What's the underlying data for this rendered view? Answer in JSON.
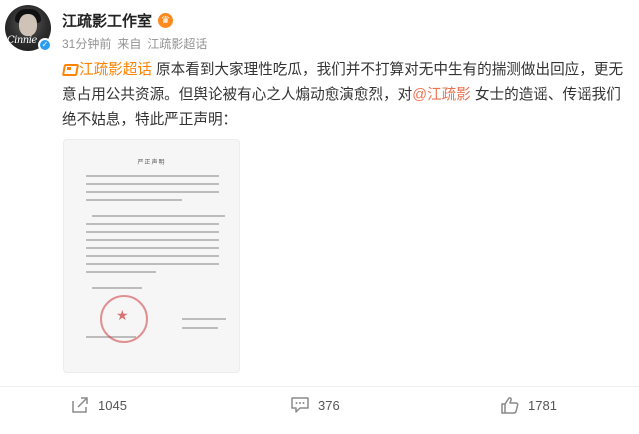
{
  "header": {
    "author": "江疏影工作室",
    "avatar_signature": "Cinnie",
    "time": "31分钟前",
    "source_prefix": "来自",
    "source": "江疏影超话"
  },
  "content": {
    "super_topic": "江疏影超话",
    "text_1": " 原本看到大家理性吃瓜，我们并不打算对无中生有的揣测做出回应，更无意占用公共资源。但舆论被有心之人煽动愈演愈烈，对",
    "mention": "@江疏影",
    "text_2": " 女士的造谣、传谣我们绝不姑息，特此严正声明："
  },
  "image": {
    "doc_title": "严正声明"
  },
  "actions": {
    "repost_count": "1045",
    "comment_count": "376",
    "like_count": "1781"
  },
  "colors": {
    "accent": "#ff8200",
    "mention": "#eb7350",
    "verified": "#2c9cf0"
  }
}
